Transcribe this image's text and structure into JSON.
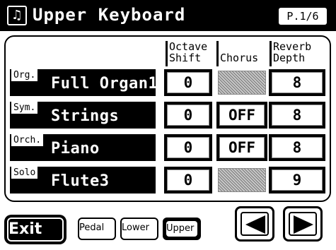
{
  "header": {
    "title": "Upper Keyboard",
    "page": "P.1/6",
    "icon": "music-note-icon"
  },
  "columns": {
    "octave_l1": "Octave",
    "octave_l2": "Shift",
    "chorus": "Chorus",
    "reverb_l1": "Reverb",
    "reverb_l2": "Depth"
  },
  "rows": [
    {
      "tag": "Org.",
      "name": "Full Organ1",
      "octave": "0",
      "chorus": "",
      "reverb": "8"
    },
    {
      "tag": "Sym.",
      "name": "Strings",
      "octave": "0",
      "chorus": "OFF",
      "reverb": "8"
    },
    {
      "tag": "Orch.",
      "name": "Piano",
      "octave": "0",
      "chorus": "OFF",
      "reverb": "8"
    },
    {
      "tag": "Solo",
      "name": "Flute3",
      "octave": "0",
      "chorus": "",
      "reverb": "9"
    }
  ],
  "footer": {
    "exit": "Exit",
    "pedal": "Pedal",
    "lower": "Lower",
    "upper": "Upper",
    "selected": "Upper"
  },
  "colors": {
    "background": "#ffffff",
    "foreground": "#000000"
  }
}
